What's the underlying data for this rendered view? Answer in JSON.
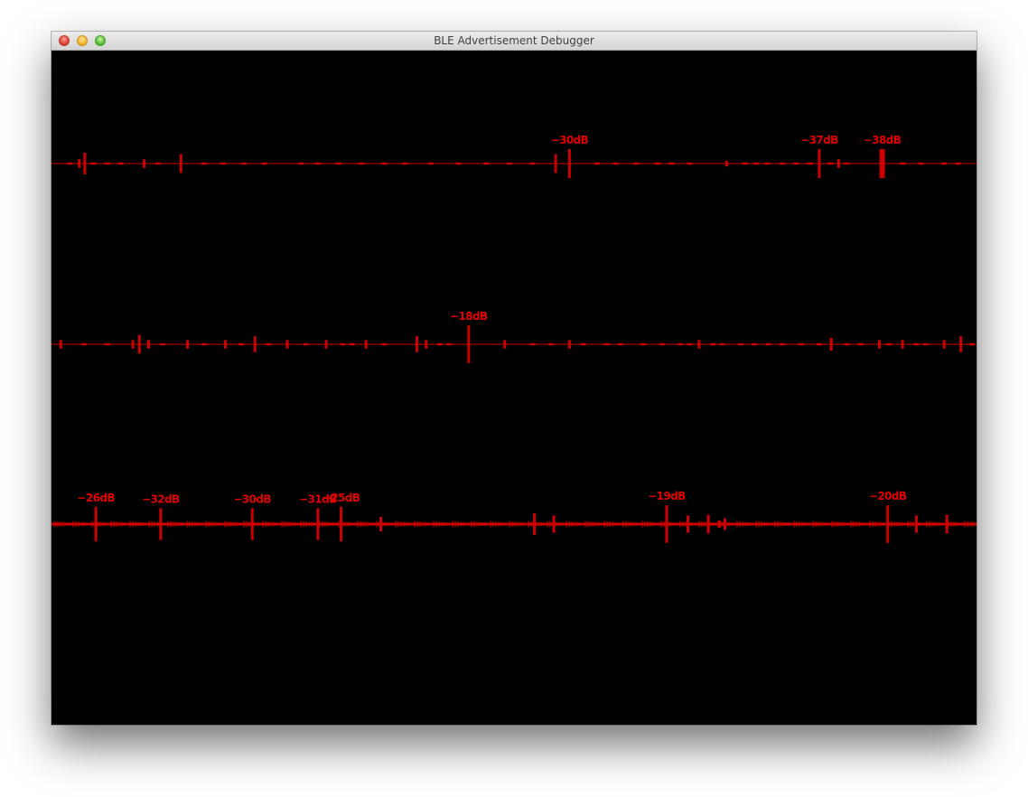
{
  "window": {
    "title": "BLE Advertisement Debugger"
  },
  "colors": {
    "background": "#000000",
    "trace": "#cc0000",
    "label": "#e00000"
  },
  "chart_data": {
    "type": "strip",
    "rows": [
      {
        "peaks": [
          {
            "position": 0.036,
            "strength": 0.3
          },
          {
            "position": 0.03,
            "strength": 0.12
          },
          {
            "position": 0.1,
            "strength": 0.12
          },
          {
            "position": 0.14,
            "strength": 0.26
          },
          {
            "position": 0.545,
            "strength": 0.26
          },
          {
            "position": 0.56,
            "strength": 0.4,
            "label": "−30dB"
          },
          {
            "position": 0.73,
            "strength": 0.08
          },
          {
            "position": 0.83,
            "strength": 0.4,
            "label": "−37dB"
          },
          {
            "position": 0.851,
            "strength": 0.12
          },
          {
            "position": 0.898,
            "strength": 0.4,
            "label": "−38dB",
            "thick": true
          }
        ],
        "minor": [
          0.02,
          0.045,
          0.06,
          0.075,
          0.115,
          0.165,
          0.185,
          0.208,
          0.23,
          0.27,
          0.288,
          0.31,
          0.335,
          0.36,
          0.382,
          0.41,
          0.44,
          0.47,
          0.495,
          0.52,
          0.59,
          0.61,
          0.632,
          0.655,
          0.67,
          0.69,
          0.75,
          0.762,
          0.774,
          0.79,
          0.805,
          0.82,
          0.842,
          0.86,
          0.92,
          0.94,
          0.965,
          0.98
        ]
      },
      {
        "peaks": [
          {
            "position": 0.01,
            "strength": 0.12
          },
          {
            "position": 0.095,
            "strength": 0.26
          },
          {
            "position": 0.088,
            "strength": 0.12
          },
          {
            "position": 0.105,
            "strength": 0.12
          },
          {
            "position": 0.147,
            "strength": 0.12
          },
          {
            "position": 0.188,
            "strength": 0.12
          },
          {
            "position": 0.22,
            "strength": 0.22
          },
          {
            "position": 0.255,
            "strength": 0.12
          },
          {
            "position": 0.297,
            "strength": 0.12
          },
          {
            "position": 0.34,
            "strength": 0.12
          },
          {
            "position": 0.395,
            "strength": 0.22
          },
          {
            "position": 0.405,
            "strength": 0.12
          },
          {
            "position": 0.451,
            "strength": 0.52,
            "label": "−18dB"
          },
          {
            "position": 0.49,
            "strength": 0.12
          },
          {
            "position": 0.56,
            "strength": 0.12
          },
          {
            "position": 0.7,
            "strength": 0.12
          },
          {
            "position": 0.843,
            "strength": 0.18
          },
          {
            "position": 0.895,
            "strength": 0.12
          },
          {
            "position": 0.92,
            "strength": 0.12
          },
          {
            "position": 0.965,
            "strength": 0.12
          },
          {
            "position": 0.983,
            "strength": 0.22
          }
        ],
        "minor": [
          0.035,
          0.06,
          0.12,
          0.165,
          0.205,
          0.235,
          0.275,
          0.315,
          0.325,
          0.36,
          0.42,
          0.43,
          0.52,
          0.54,
          0.575,
          0.6,
          0.615,
          0.64,
          0.66,
          0.68,
          0.69,
          0.715,
          0.725,
          0.745,
          0.76,
          0.775,
          0.79,
          0.81,
          0.83,
          0.86,
          0.875,
          0.905,
          0.935,
          0.945,
          0.995
        ]
      },
      {
        "dense": true,
        "peaks": [
          {
            "position": 0.048,
            "strength": 0.48,
            "label": "−26dB"
          },
          {
            "position": 0.118,
            "strength": 0.44,
            "label": "−32dB"
          },
          {
            "position": 0.217,
            "strength": 0.44,
            "label": "−30dB"
          },
          {
            "position": 0.288,
            "strength": 0.44,
            "label": "−31dB"
          },
          {
            "position": 0.313,
            "strength": 0.48,
            "label": "−25dB"
          },
          {
            "position": 0.356,
            "strength": 0.2
          },
          {
            "position": 0.522,
            "strength": 0.3
          },
          {
            "position": 0.543,
            "strength": 0.24
          },
          {
            "position": 0.665,
            "strength": 0.52,
            "label": "−19dB"
          },
          {
            "position": 0.688,
            "strength": 0.24
          },
          {
            "position": 0.71,
            "strength": 0.26
          },
          {
            "position": 0.722,
            "strength": 0.1
          },
          {
            "position": 0.728,
            "strength": 0.16
          },
          {
            "position": 0.904,
            "strength": 0.52,
            "label": "−20dB"
          },
          {
            "position": 0.935,
            "strength": 0.24
          },
          {
            "position": 0.968,
            "strength": 0.26
          }
        ],
        "minor": []
      }
    ]
  }
}
